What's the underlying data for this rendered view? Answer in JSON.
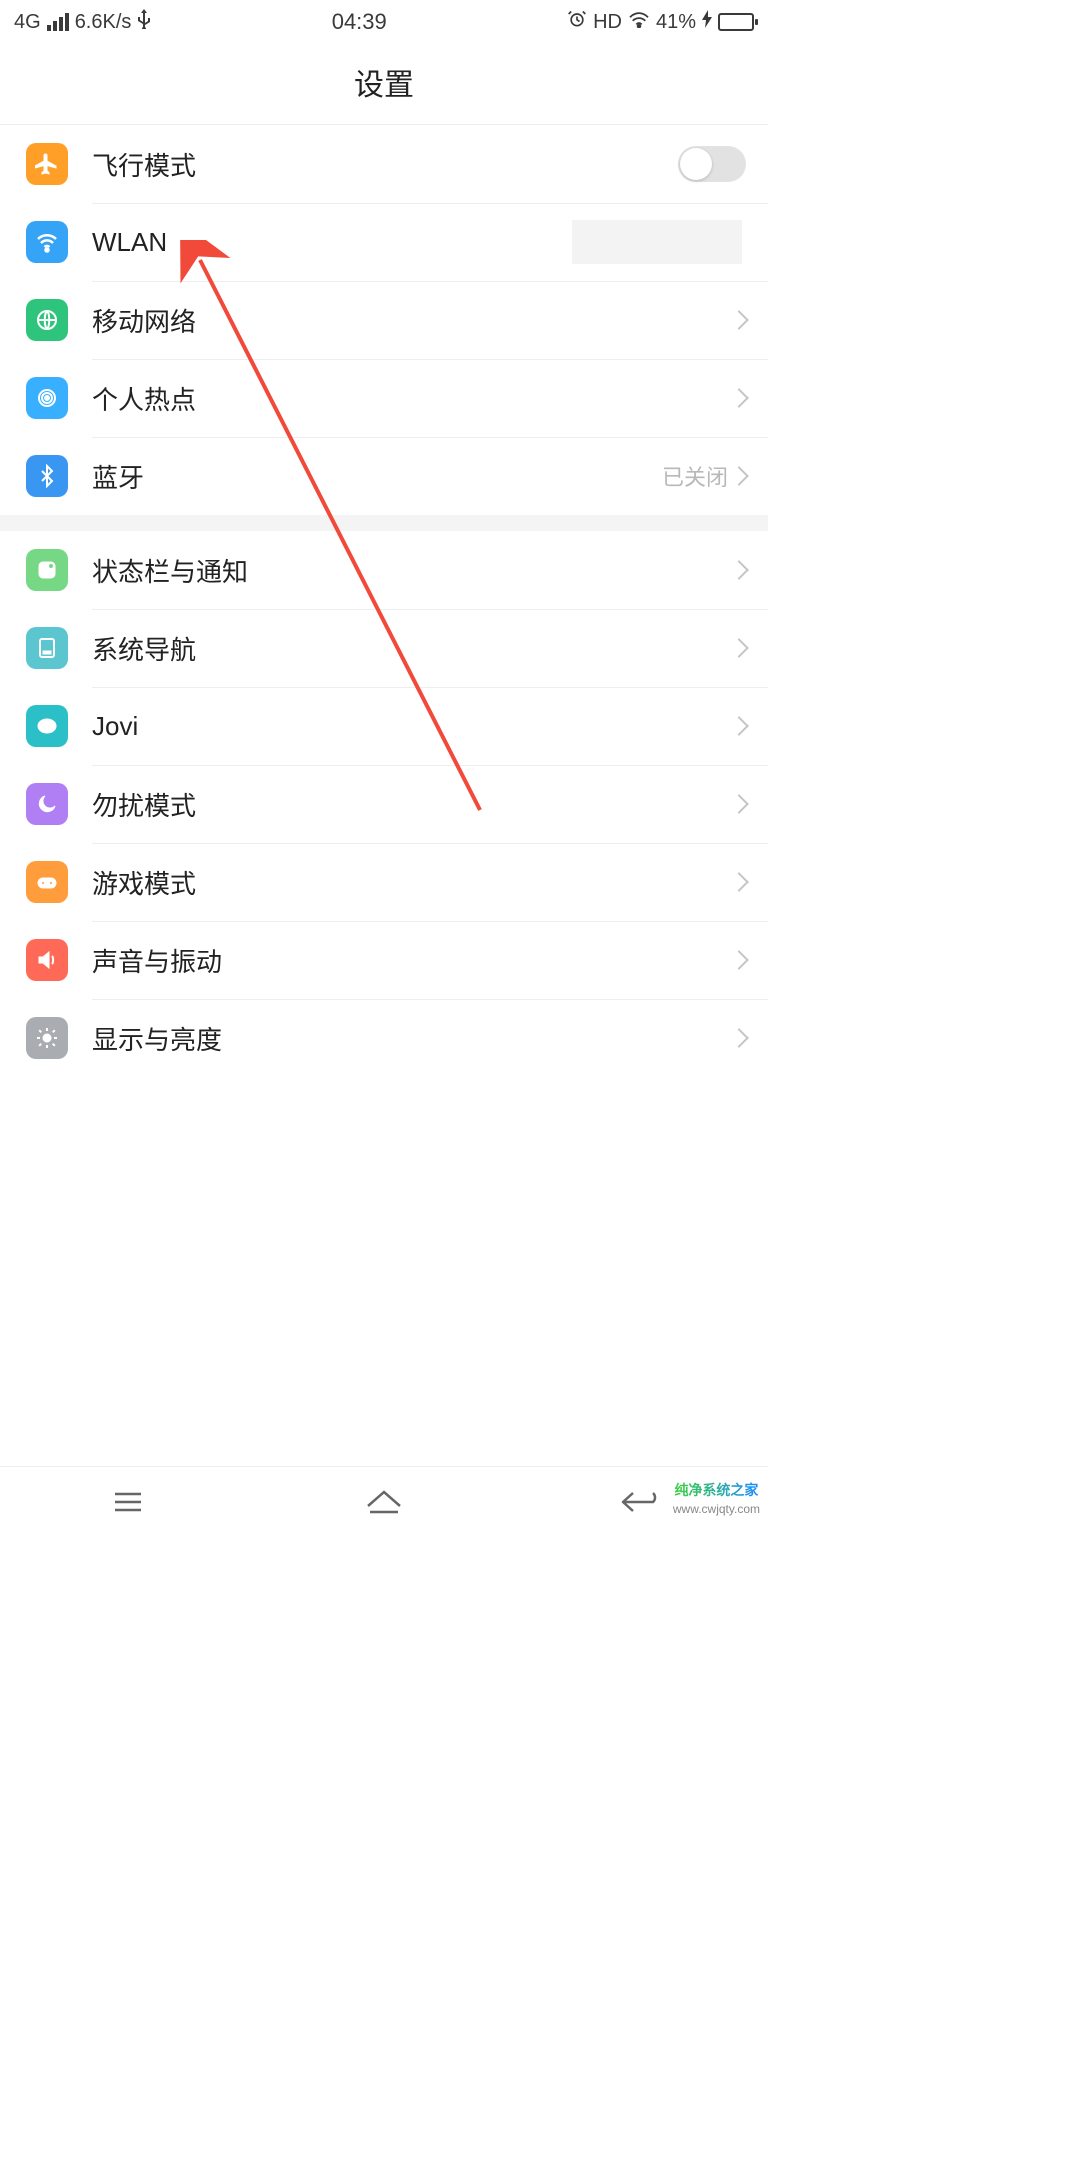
{
  "status": {
    "network_type": "4G",
    "speed": "6.6K/s",
    "usb": "⎋",
    "time": "04:39",
    "alarm": "⏰",
    "hd": "HD",
    "battery_pct": "41%",
    "charging": "⚡"
  },
  "header": {
    "title": "设置"
  },
  "groups": [
    {
      "rows": [
        {
          "key": "airplane",
          "label": "飞行模式",
          "icon": "airplane-icon",
          "bg": "bg-orange",
          "control": "toggle",
          "toggle_on": false
        },
        {
          "key": "wlan",
          "label": "WLAN",
          "icon": "wifi-icon",
          "bg": "bg-blue",
          "control": "value_placeholder"
        },
        {
          "key": "mobile",
          "label": "移动网络",
          "icon": "globe-icon",
          "bg": "bg-green",
          "control": "chevron"
        },
        {
          "key": "hotspot",
          "label": "个人热点",
          "icon": "hotspot-icon",
          "bg": "bg-cyan",
          "control": "chevron"
        },
        {
          "key": "bluetooth",
          "label": "蓝牙",
          "icon": "bluetooth-icon",
          "bg": "bg-blue2",
          "control": "chevron",
          "value": "已关闭"
        }
      ]
    },
    {
      "rows": [
        {
          "key": "status_notify",
          "label": "状态栏与通知",
          "icon": "notify-icon",
          "bg": "bg-lime",
          "control": "chevron"
        },
        {
          "key": "nav",
          "label": "系统导航",
          "icon": "nav-icon",
          "bg": "bg-sky",
          "control": "chevron"
        },
        {
          "key": "jovi",
          "label": "Jovi",
          "icon": "jovi-icon",
          "bg": "bg-teal",
          "control": "chevron"
        },
        {
          "key": "dnd",
          "label": "勿扰模式",
          "icon": "moon-icon",
          "bg": "bg-purple",
          "control": "chevron"
        },
        {
          "key": "game",
          "label": "游戏模式",
          "icon": "game-icon",
          "bg": "bg-amber",
          "control": "chevron"
        },
        {
          "key": "sound",
          "label": "声音与振动",
          "icon": "sound-icon",
          "bg": "bg-red",
          "control": "chevron"
        },
        {
          "key": "display",
          "label": "显示与亮度",
          "icon": "brightness-icon",
          "bg": "bg-gray",
          "control": "chevron"
        }
      ]
    }
  ],
  "watermark": {
    "logo": "纯净系统之家",
    "url": "www.cwjqty.com"
  },
  "colors": {
    "annotation": "#f14a3b"
  }
}
